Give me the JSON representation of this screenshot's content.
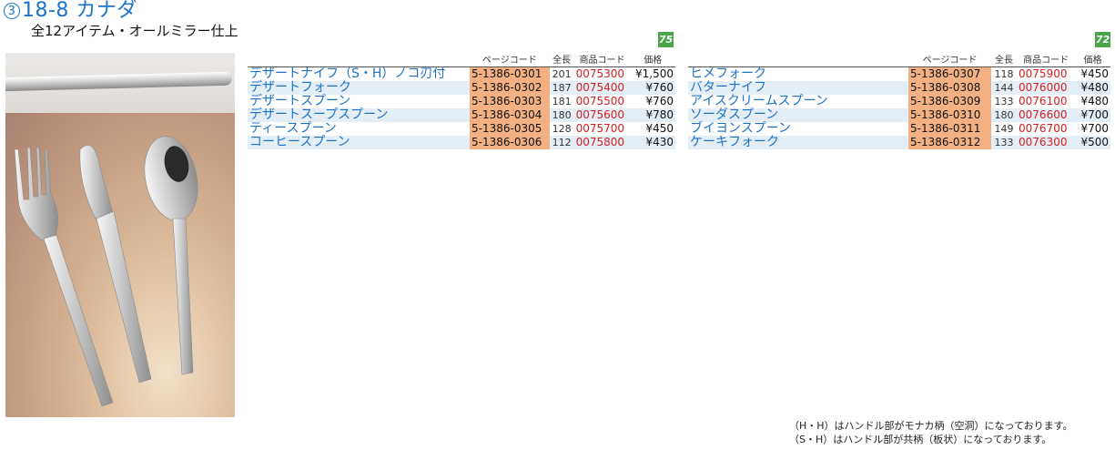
{
  "header": {
    "number": "3",
    "title": "18-8 カナダ",
    "subtitle": "全12アイテム・オールミラー仕上"
  },
  "badges": {
    "left": "75",
    "right": "72"
  },
  "columns": {
    "page_code": "ページコード",
    "length": "全長",
    "product_code": "商品コード",
    "price": "価格"
  },
  "left_table": [
    {
      "name": "デザートナイフ（S・H）ノコ刃付",
      "page_code": "5-1386-0301",
      "length": "201",
      "product_code": "0075300",
      "price": "¥1,500"
    },
    {
      "name": "デザートフォーク",
      "page_code": "5-1386-0302",
      "length": "187",
      "product_code": "0075400",
      "price": "¥760"
    },
    {
      "name": "デザートスプーン",
      "page_code": "5-1386-0303",
      "length": "181",
      "product_code": "0075500",
      "price": "¥760"
    },
    {
      "name": "デザートスープスプーン",
      "page_code": "5-1386-0304",
      "length": "180",
      "product_code": "0075600",
      "price": "¥780"
    },
    {
      "name": "ティースプーン",
      "page_code": "5-1386-0305",
      "length": "128",
      "product_code": "0075700",
      "price": "¥450"
    },
    {
      "name": "コーヒースプーン",
      "page_code": "5-1386-0306",
      "length": "112",
      "product_code": "0075800",
      "price": "¥430"
    }
  ],
  "right_table": [
    {
      "name": "ヒメフォーク",
      "page_code": "5-1386-0307",
      "length": "118",
      "product_code": "0075900",
      "price": "¥450"
    },
    {
      "name": "バターナイフ",
      "page_code": "5-1386-0308",
      "length": "144",
      "product_code": "0076000",
      "price": "¥480"
    },
    {
      "name": "アイスクリームスプーン",
      "page_code": "5-1386-0309",
      "length": "133",
      "product_code": "0076100",
      "price": "¥480"
    },
    {
      "name": "ソーダスプーン",
      "page_code": "5-1386-0310",
      "length": "180",
      "product_code": "0076600",
      "price": "¥700"
    },
    {
      "name": "ブイヨンスプーン",
      "page_code": "5-1386-0311",
      "length": "149",
      "product_code": "0076700",
      "price": "¥700"
    },
    {
      "name": "ケーキフォーク",
      "page_code": "5-1386-0312",
      "length": "133",
      "product_code": "0076300",
      "price": "¥500"
    }
  ],
  "notes": [
    "（H・H）はハンドル部がモナカ柄（空洞）になっております。",
    "（S・H）はハンドル部が共柄（板状）になっております。"
  ],
  "colors": {
    "title_blue": "#1e73c8",
    "code_highlight": "#f3b183",
    "product_code_red": "#d42020",
    "badge_green": "#4aa54a"
  }
}
